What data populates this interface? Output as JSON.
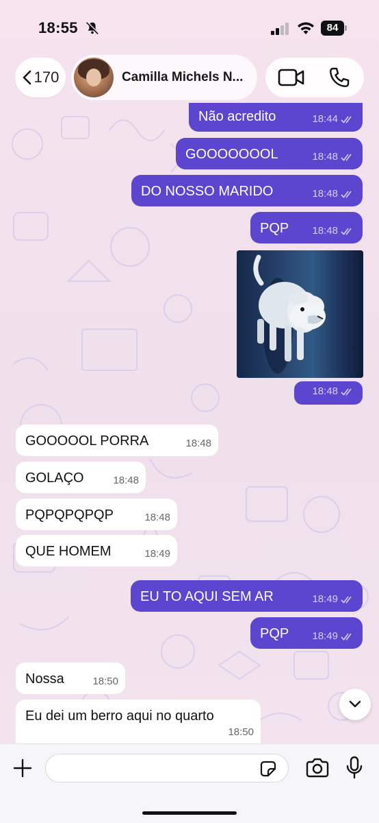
{
  "status_bar": {
    "time": "18:55",
    "battery": "84"
  },
  "header": {
    "back_count": "170",
    "contact_name": "Camilla Michels N..."
  },
  "messages": [
    {
      "dir": "out",
      "text": "Não acredito",
      "time": "18:44"
    },
    {
      "dir": "out",
      "text": "GOOOOOOOL",
      "time": "18:48"
    },
    {
      "dir": "out",
      "text": "DO NOSSO MARIDO",
      "time": "18:48"
    },
    {
      "dir": "out",
      "text": "PQP",
      "time": "18:48"
    },
    {
      "dir": "out",
      "type": "image",
      "time": "18:48"
    },
    {
      "dir": "in",
      "text": "GOOOOOL PORRA",
      "time": "18:48"
    },
    {
      "dir": "in",
      "text": "GOLAÇO",
      "time": "18:48"
    },
    {
      "dir": "in",
      "text": "PQPQPQPQP",
      "time": "18:48"
    },
    {
      "dir": "in",
      "text": "QUE HOMEM",
      "time": "18:49"
    },
    {
      "dir": "out",
      "text": "EU TO AQUI SEM AR",
      "time": "18:49"
    },
    {
      "dir": "out",
      "text": "PQP",
      "time": "18:49"
    },
    {
      "dir": "in",
      "text": "Nossa",
      "time": "18:50"
    },
    {
      "dir": "in",
      "text": "Eu dei um berro aqui no quarto",
      "time": "18:50"
    }
  ],
  "composer": {
    "input_value": ""
  },
  "colors": {
    "outgoing_bubble": "#5c46d0",
    "incoming_bubble": "#ffffff",
    "chat_background": "#f3e6ee"
  },
  "icons": [
    "mute-bell-icon",
    "signal-icon",
    "wifi-icon",
    "back-chevron-icon",
    "video-call-icon",
    "phone-call-icon",
    "read-receipt-icon",
    "scroll-down-icon",
    "plus-icon",
    "sticker-icon",
    "camera-icon",
    "microphone-icon"
  ]
}
